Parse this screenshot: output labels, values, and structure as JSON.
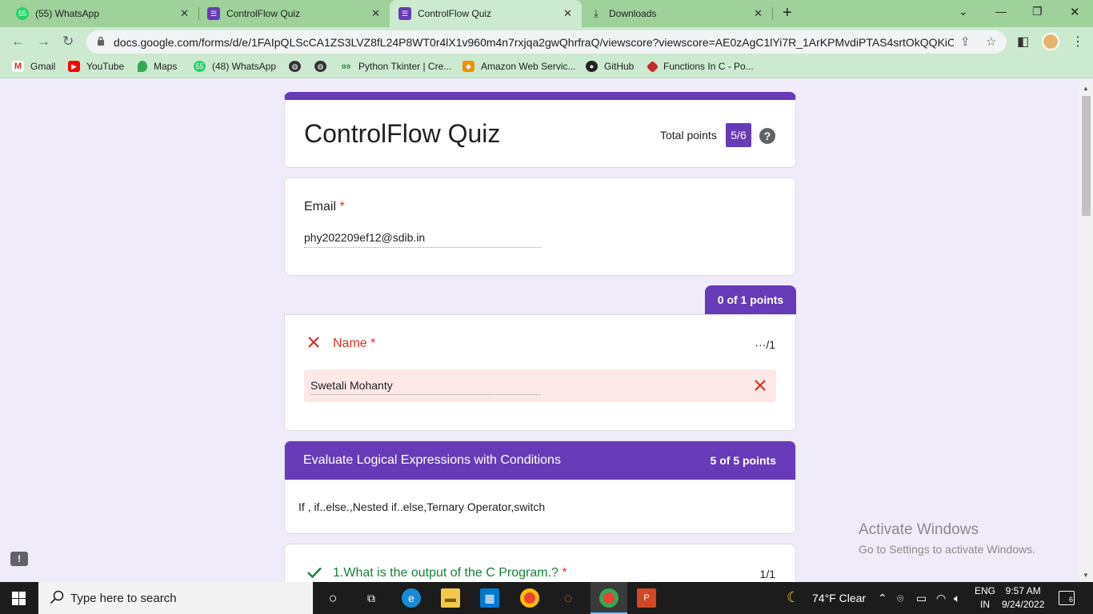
{
  "browser": {
    "tabs": [
      {
        "label": "(55) WhatsApp",
        "icon": "whatsapp-icon"
      },
      {
        "label": "ControlFlow Quiz",
        "icon": "google-forms-icon"
      },
      {
        "label": "ControlFlow Quiz",
        "icon": "google-forms-icon",
        "active": true
      },
      {
        "label": "Downloads",
        "icon": "download-icon"
      }
    ],
    "url": "docs.google.com/forms/d/e/1FAIpQLScCA1ZS3LVZ8fL24P8WT0r4lX1v960m4n7rxjqa2gwQhrfraQ/viewscore?viewscore=AE0zAgC1lYi7R_1ArKPMvdiPTAS4srtOkQQKiOLf...",
    "bookmarks": [
      {
        "label": "Gmail",
        "icon": "gmail-icon"
      },
      {
        "label": "YouTube",
        "icon": "youtube-icon"
      },
      {
        "label": "Maps",
        "icon": "maps-icon"
      },
      {
        "label": "(48) WhatsApp",
        "icon": "whatsapp-icon"
      },
      {
        "label": "",
        "icon": "globe-icon"
      },
      {
        "label": "",
        "icon": "globe-icon"
      },
      {
        "label": "Python Tkinter | Cre...",
        "icon": "geeksforgeeks-icon"
      },
      {
        "label": "Amazon Web Servic...",
        "icon": "aws-icon"
      },
      {
        "label": "GitHub",
        "icon": "github-icon"
      },
      {
        "label": "Functions In C - Po...",
        "icon": "bookmark-icon"
      }
    ]
  },
  "form": {
    "title": "ControlFlow Quiz",
    "total_points_label": "Total points",
    "total_points": "5/6",
    "email_label": "Email",
    "required_mark": "*",
    "email_value": "phy202209ef12@sdib.in",
    "name_points_tab": "0 of 1 points",
    "name_label": "Name",
    "name_score": "···/1",
    "name_value": "Swetali Mohanty",
    "section_title": "Evaluate Logical Expressions with Conditions",
    "section_points": "5 of 5 points",
    "section_description": "If , if..else.,Nested if..else,Ternary Operator,switch",
    "question1_label": "1.What is the output of the C Program.?",
    "question1_score": "1/1"
  },
  "watermark": {
    "line1": "Activate Windows",
    "line2": "Go to Settings to activate Windows."
  },
  "taskbar": {
    "search_placeholder": "Type here to search",
    "weather": "74°F  Clear",
    "lang_line1": "ENG",
    "lang_line2": "IN",
    "time": "9:57 AM",
    "date": "9/24/2022",
    "notification_count": "6"
  },
  "colors": {
    "accent": "#673ab7",
    "error": "#d93025",
    "success": "#188038",
    "page_bg": "#f0ebf8",
    "chrome_frame": "#9fd19b"
  }
}
